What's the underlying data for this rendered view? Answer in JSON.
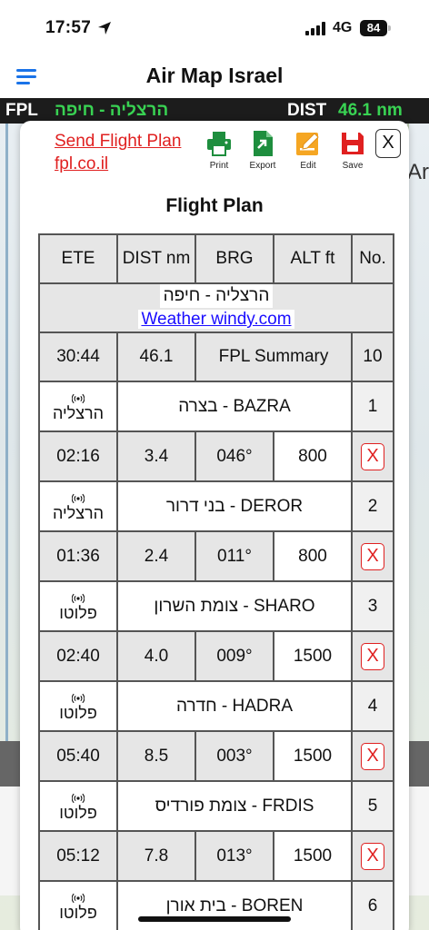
{
  "status": {
    "time": "17:57",
    "network": "4G",
    "battery": "84"
  },
  "header": {
    "title": "Air Map Israel",
    "menu_icon": "hamburger-menu-icon"
  },
  "fpl_bar": {
    "label": "FPL",
    "route": "הרצליה - חיפה",
    "dist_label": "DIST",
    "dist_value": "46.1 nm"
  },
  "map": {
    "letter_a": "Ar"
  },
  "dialog": {
    "send_link_line1": "Send Flight Plan",
    "send_link_line2": "fpl.co.il",
    "tools": [
      {
        "label": "Print",
        "icon": "print-icon",
        "color": "#1e8e3e"
      },
      {
        "label": "Export",
        "icon": "export-icon",
        "color": "#1e8e3e"
      },
      {
        "label": "Edit",
        "icon": "edit-icon",
        "color": "#f5a623"
      },
      {
        "label": "Save",
        "icon": "save-icon",
        "color": "#e02020"
      }
    ],
    "close_label": "X",
    "title": "Flight Plan"
  },
  "table": {
    "headers": [
      "ETE",
      "DIST nm",
      "BRG",
      "ALT ft",
      "No."
    ],
    "route_name": "הרצליה - חיפה",
    "weather_link": "Weather windy.com",
    "summary": {
      "ete": "30:44",
      "dist": "46.1",
      "label": "FPL Summary",
      "count": "10"
    },
    "waypoints": [
      {
        "freq": "הרצליה",
        "name": "BAZRA - בצרה",
        "no": "1",
        "ete": "02:16",
        "dist": "3.4",
        "brg": "046°",
        "alt": "800"
      },
      {
        "freq": "הרצליה",
        "name": "DEROR - בני דרור",
        "no": "2",
        "ete": "01:36",
        "dist": "2.4",
        "brg": "011°",
        "alt": "800"
      },
      {
        "freq": "פלוטו",
        "name": "SHARO - צומת השרון",
        "no": "3",
        "ete": "02:40",
        "dist": "4.0",
        "brg": "009°",
        "alt": "1500"
      },
      {
        "freq": "פלוטו",
        "name": "HADRA - חדרה",
        "no": "4",
        "ete": "05:40",
        "dist": "8.5",
        "brg": "003°",
        "alt": "1500"
      },
      {
        "freq": "פלוטו",
        "name": "FRDIS - צומת פורדיס",
        "no": "5",
        "ete": "05:12",
        "dist": "7.8",
        "brg": "013°",
        "alt": "1500"
      },
      {
        "freq": "פלוטו",
        "name": "BOREN - בית אורן",
        "no": "6"
      }
    ],
    "delete_label": "X"
  }
}
